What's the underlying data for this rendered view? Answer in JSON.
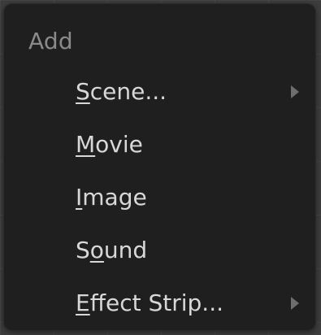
{
  "menu": {
    "title": "Add",
    "items": [
      {
        "label_prefix": "",
        "mnemonic": "S",
        "label_suffix": "cene...",
        "has_submenu": true,
        "arrow_icon": "triangle-right-icon"
      },
      {
        "label_prefix": "",
        "mnemonic": "M",
        "label_suffix": "ovie",
        "has_submenu": false
      },
      {
        "label_prefix": "",
        "mnemonic": "I",
        "label_suffix": "mage",
        "has_submenu": false
      },
      {
        "label_prefix": "S",
        "mnemonic": "o",
        "label_suffix": "und",
        "has_submenu": false
      },
      {
        "label_prefix": "",
        "mnemonic": "E",
        "label_suffix": "ffect Strip...",
        "has_submenu": true,
        "arrow_icon": "triangle-right-icon"
      }
    ]
  },
  "colors": {
    "menu_background": "#1f1f1f",
    "title_text": "#8a8a8a",
    "item_text": "#d8d8d8",
    "arrow": "#6e6e6e"
  }
}
